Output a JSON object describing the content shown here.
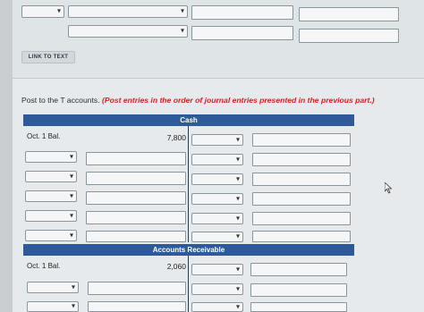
{
  "top_section": {
    "link_button_label": "LINK TO TEXT"
  },
  "instructions": {
    "prefix": "Post to the T accounts.",
    "highlight": "(Post entries in the order of journal entries presented in the previous part.)"
  },
  "t_accounts": [
    {
      "title": "Cash",
      "opening_label": "Oct. 1 Bal.",
      "opening_amount": "7,800"
    },
    {
      "title": "Accounts Receivable",
      "opening_label": "Oct. 1 Bal.",
      "opening_amount": "2,060"
    }
  ],
  "icons": {
    "dropdown": "chevron-down-icon",
    "cursor": "mouse-cursor-icon"
  },
  "colors": {
    "header_blue": "#2f5a9a",
    "instruction_red": "#d42020"
  }
}
